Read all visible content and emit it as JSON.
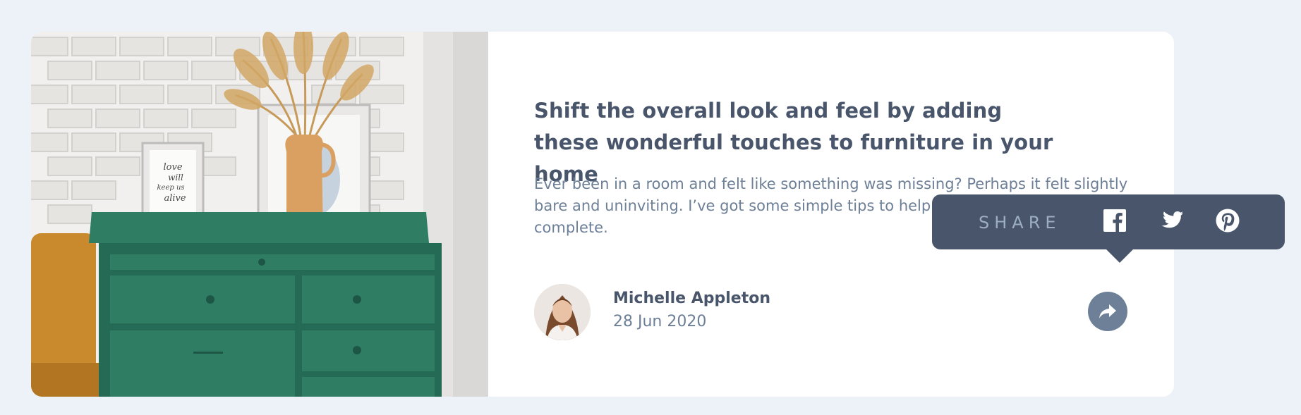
{
  "article": {
    "title": "Shift the overall look and feel by adding these wonderful touches to furniture in your home",
    "excerpt": "Ever been in a room and felt like something was missing? Perhaps it felt slightly bare and uninviting. I’ve got some simple tips to help you make any room feel complete.",
    "image_alt": "Green drawer cabinet with framed print and vase of dried grass",
    "frame_text": [
      "love",
      "will",
      "keep us",
      "alive"
    ]
  },
  "author": {
    "name": "Michelle Appleton",
    "date": "28 Jun 2020"
  },
  "share": {
    "label": "SHARE",
    "networks": [
      {
        "name": "facebook",
        "icon": "facebook-icon"
      },
      {
        "name": "twitter",
        "icon": "twitter-icon"
      },
      {
        "name": "pinterest",
        "icon": "pinterest-icon"
      }
    ],
    "button_icon": "share-arrow-icon"
  },
  "colors": {
    "page_background": "#ecf2f8",
    "card_background": "#ffffff",
    "heading": "#48556a",
    "body_text": "#6d7f97",
    "tooltip_background": "#48556a",
    "share_label": "#9daec2",
    "share_button": "#6e8098",
    "cabinet_green": "#2e7a62"
  }
}
